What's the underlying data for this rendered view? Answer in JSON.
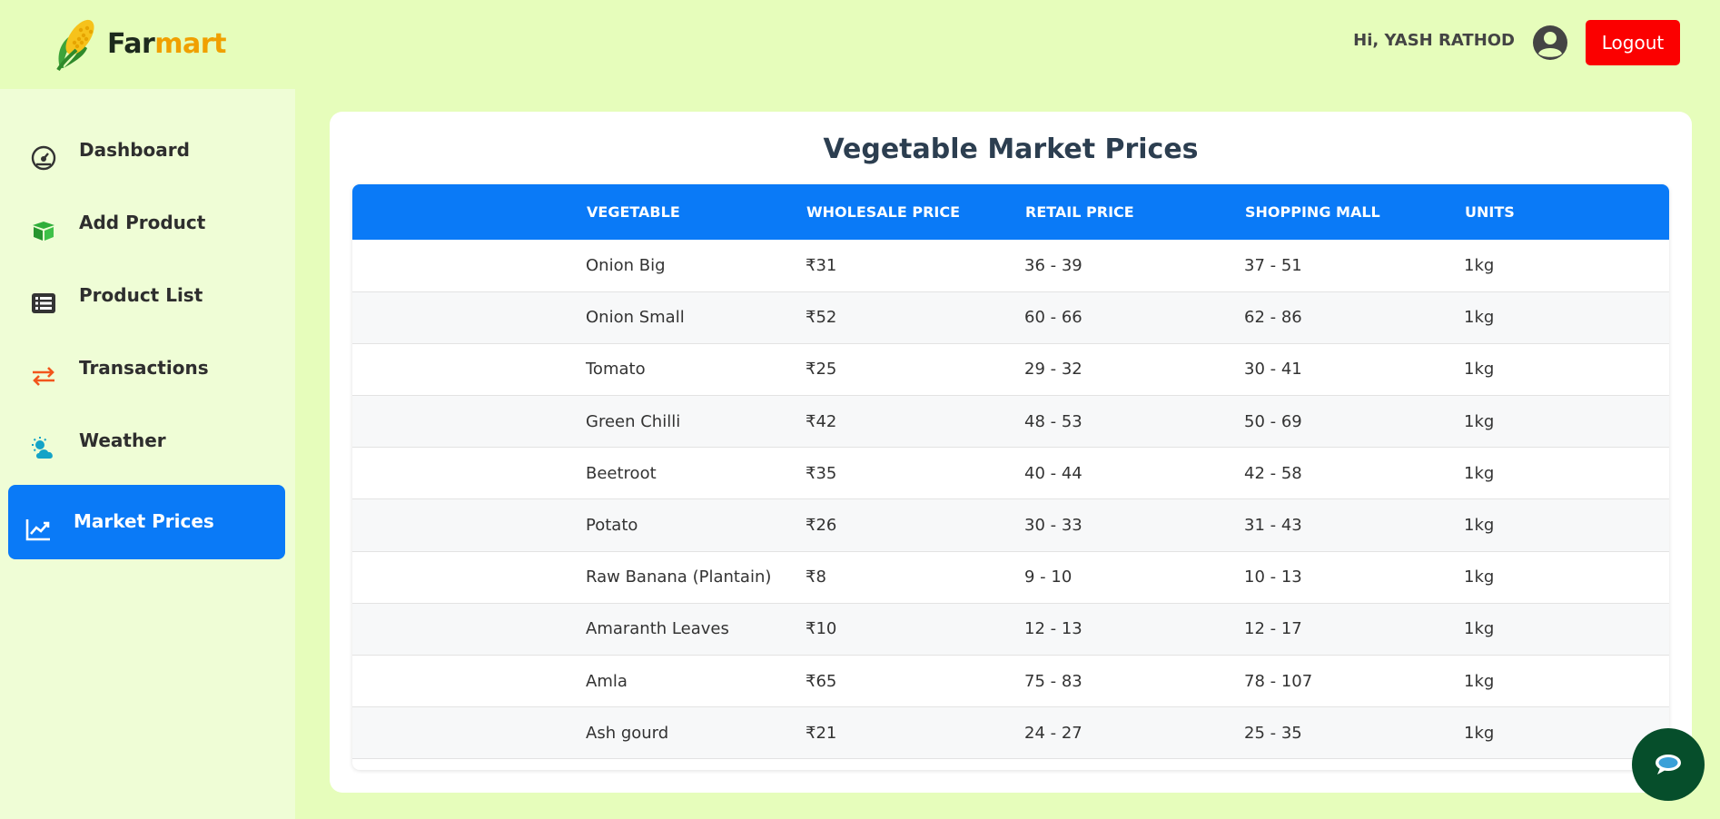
{
  "brand": {
    "part1": "Far",
    "part2": "mart"
  },
  "header": {
    "greeting": "Hi, YASH RATHOD",
    "logout_label": "Logout"
  },
  "sidebar": {
    "items": [
      {
        "label": "Dashboard",
        "icon": "dashboard-icon"
      },
      {
        "label": "Add Product",
        "icon": "box-icon"
      },
      {
        "label": "Product List",
        "icon": "list-icon"
      },
      {
        "label": "Transactions",
        "icon": "exchange-icon"
      },
      {
        "label": "Weather",
        "icon": "weather-icon"
      },
      {
        "label": "Market Prices",
        "icon": "chart-line-icon",
        "active": true
      }
    ]
  },
  "main": {
    "title": "Vegetable Market Prices",
    "columns": [
      "VEGETABLE",
      "WHOLESALE PRICE",
      "RETAIL PRICE",
      "SHOPPING MALL",
      "UNITS"
    ],
    "rows": [
      [
        "Onion Big",
        "₹31",
        "36 - 39",
        "37 - 51",
        "1kg"
      ],
      [
        "Onion Small",
        "₹52",
        "60 - 66",
        "62 - 86",
        "1kg"
      ],
      [
        "Tomato",
        "₹25",
        "29 - 32",
        "30 - 41",
        "1kg"
      ],
      [
        "Green Chilli",
        "₹42",
        "48 - 53",
        "50 - 69",
        "1kg"
      ],
      [
        "Beetroot",
        "₹35",
        "40 - 44",
        "42 - 58",
        "1kg"
      ],
      [
        "Potato",
        "₹26",
        "30 - 33",
        "31 - 43",
        "1kg"
      ],
      [
        "Raw Banana (Plantain)",
        "₹8",
        "9 - 10",
        "10 - 13",
        "1kg"
      ],
      [
        "Amaranth Leaves",
        "₹10",
        "12 - 13",
        "12 - 17",
        "1kg"
      ],
      [
        "Amla",
        "₹65",
        "75 - 83",
        "78 - 107",
        "1kg"
      ],
      [
        "Ash gourd",
        "₹21",
        "24 - 27",
        "25 - 35",
        "1kg"
      ]
    ]
  },
  "colors": {
    "background": "#e6fdbb",
    "sidebar": "#effdd6",
    "accent": "#0a7af7",
    "logout": "#fb0000",
    "chat": "#064e2b"
  }
}
